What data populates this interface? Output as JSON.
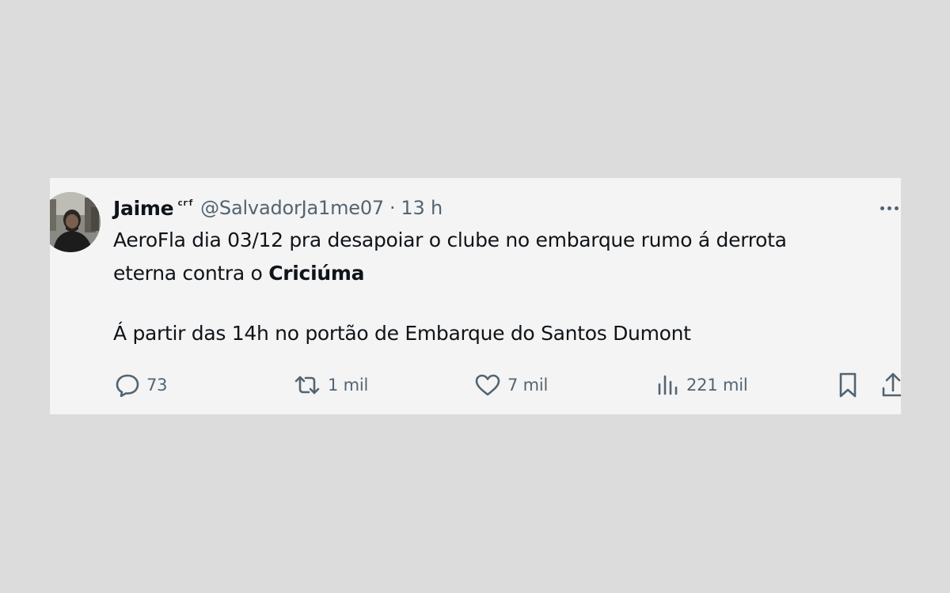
{
  "tweet": {
    "author": {
      "display_name": "Jaime",
      "badge": "crf",
      "handle": "@SalvadorJa1me07",
      "separator": "·",
      "time": "13 h"
    },
    "body": {
      "line1_text": "AeroFla dia 03/12 pra desapoiar o clube no embarque rumo á derrota",
      "line2_text": "eterna contra o ",
      "line2_bold": "Criciúma",
      "line3_text": "Á partir das 14h no portão de Embarque do Santos Dumont"
    },
    "actions": {
      "replies": {
        "icon": "reply-icon",
        "count": "73"
      },
      "reposts": {
        "icon": "repost-icon",
        "count": "1 mil"
      },
      "likes": {
        "icon": "heart-icon",
        "count": "7 mil"
      },
      "views": {
        "icon": "views-chart-icon",
        "count": "221 mil"
      },
      "bookmark": {
        "icon": "bookmark-icon"
      },
      "share": {
        "icon": "share-icon"
      }
    }
  },
  "colors": {
    "page_background": "#dcdcdc",
    "card_background": "#f4f4f4",
    "primary_text": "#0f1419",
    "secondary_text": "#536471"
  }
}
